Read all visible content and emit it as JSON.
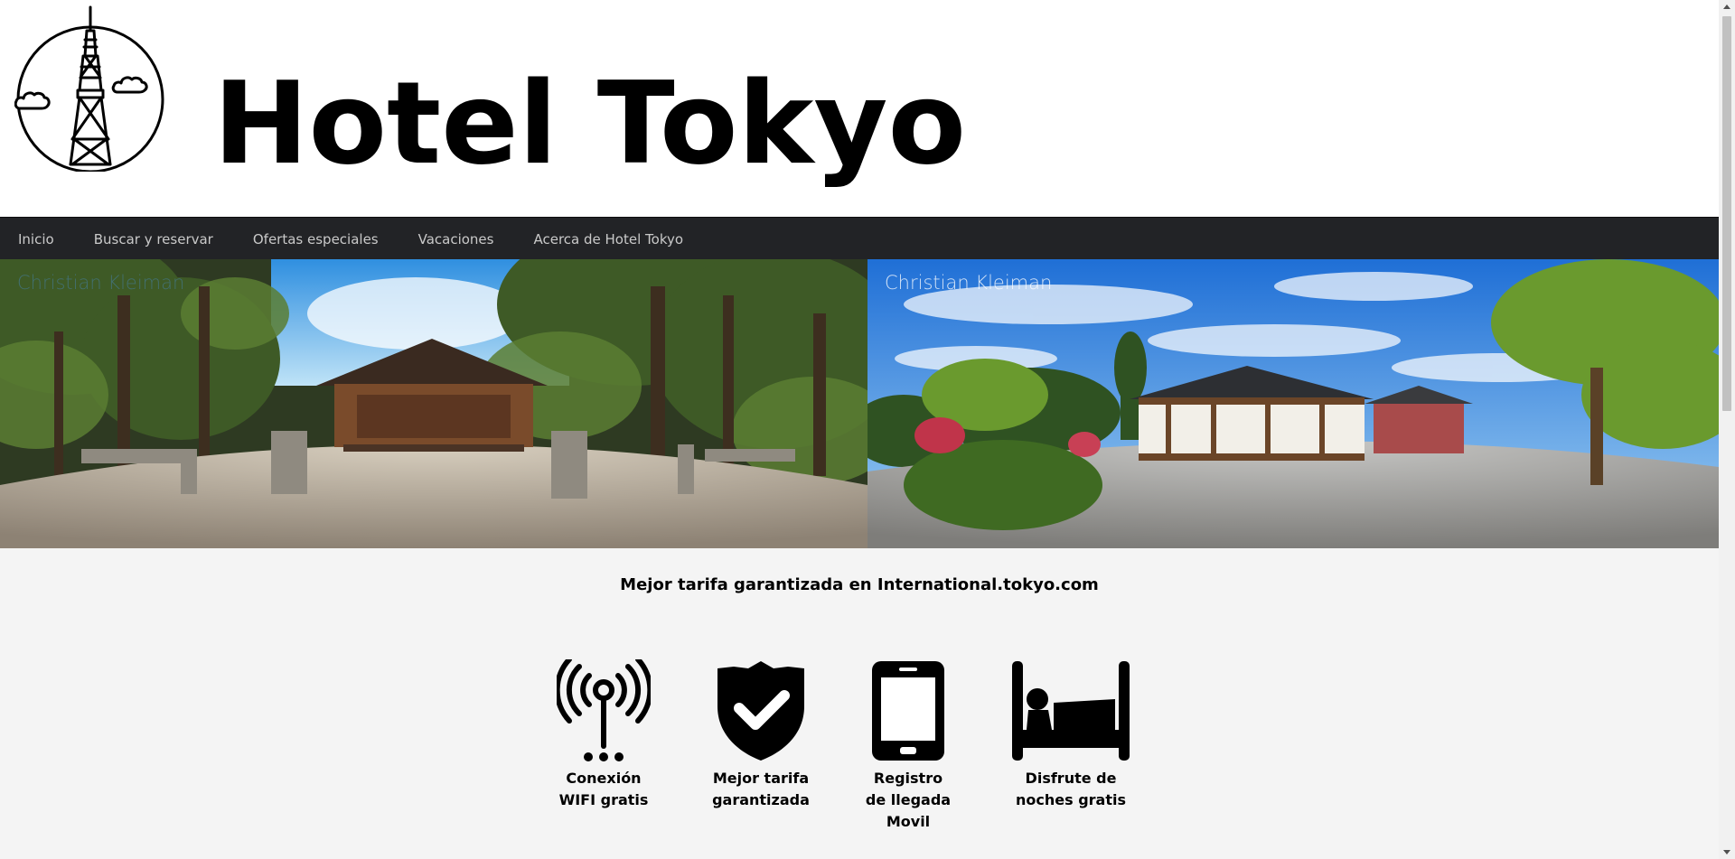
{
  "header": {
    "title": "Hotel Tokyo",
    "logo_icon": "tokyo-tower-icon"
  },
  "nav": {
    "items": [
      {
        "label": "Inicio"
      },
      {
        "label": "Buscar y reservar"
      },
      {
        "label": "Ofertas especiales"
      },
      {
        "label": "Vacaciones"
      },
      {
        "label": "Acerca de Hotel Tokyo"
      }
    ]
  },
  "banner": {
    "left_credit": "Christian Kleiman",
    "right_credit": "Christian Kleiman"
  },
  "tagline": "Mejor tarifa garantizada en International.tokyo.com",
  "features": [
    {
      "icon": "wifi-antenna-icon",
      "line1": "Conexión",
      "line2": "WIFI gratis",
      "line3": ""
    },
    {
      "icon": "shield-check-icon",
      "line1": "Mejor tarifa",
      "line2": "garantizada",
      "line3": ""
    },
    {
      "icon": "smartphone-icon",
      "line1": "Registro",
      "line2": "de llegada",
      "line3": "Movil"
    },
    {
      "icon": "bed-icon",
      "line1": "Disfrute de",
      "line2": "noches gratis",
      "line3": ""
    }
  ],
  "colors": {
    "navbar": "#222326",
    "nav_text": "#c9c9c9",
    "page_bg": "#f4f4f4"
  }
}
